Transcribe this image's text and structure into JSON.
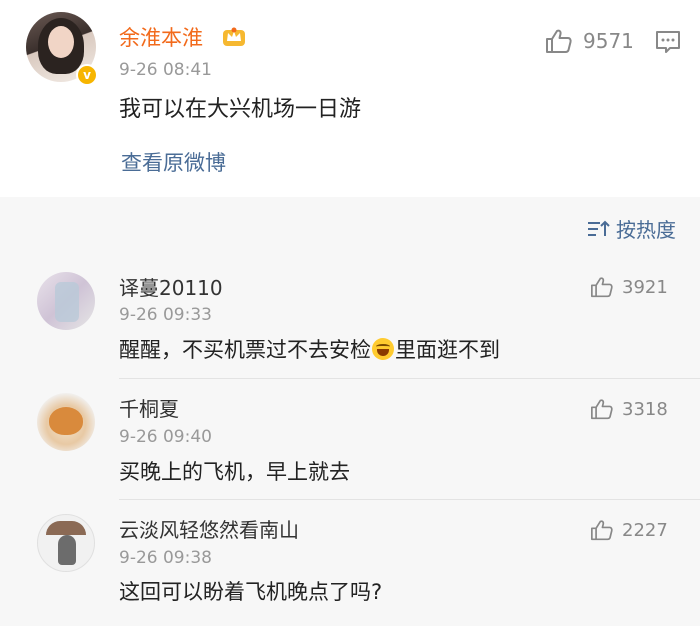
{
  "post": {
    "author": "余淮本淮",
    "time": "9-26 08:41",
    "content": "我可以在大兴机场一日游",
    "view_original": "查看原微博",
    "likes": "9571"
  },
  "sort": {
    "label": "按热度"
  },
  "comments": [
    {
      "name": "译蔓20110",
      "time": "9-26 09:33",
      "text_before": "醒醒，不买机票过不去安检",
      "text_after": "里面逛不到",
      "likes": "3921"
    },
    {
      "name": "千桐夏",
      "time": "9-26 09:40",
      "text": "买晚上的飞机，早上就去",
      "likes": "3318"
    },
    {
      "name": "云淡风轻悠然看南山",
      "time": "9-26 09:38",
      "text": "这回可以盼着飞机晚点了吗?",
      "likes": "2227"
    }
  ],
  "colors": {
    "author": "#f26a1b",
    "link": "#4a6c96",
    "muted": "#999999",
    "badge": "#f7b500"
  },
  "icons": {
    "like": "thumbs-up-icon",
    "comment": "comment-icon",
    "sort": "sort-icon",
    "badge": "verified-badge-icon",
    "member": "crown-icon",
    "emoji": "laughing-emoji-icon"
  }
}
